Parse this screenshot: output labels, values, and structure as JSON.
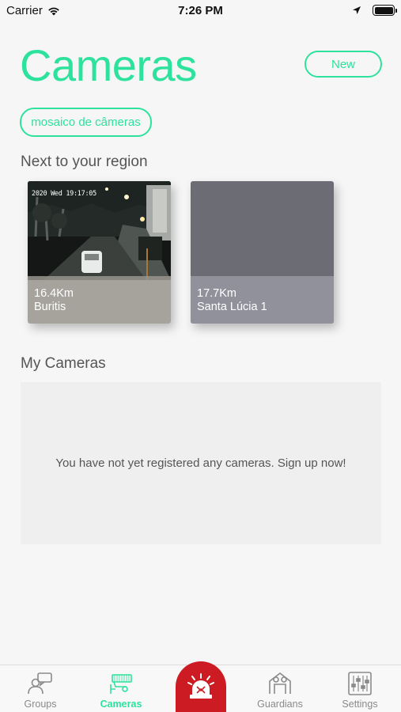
{
  "status_bar": {
    "carrier": "Carrier",
    "time": "7:26 PM"
  },
  "header": {
    "title": "Cameras",
    "new_label": "New"
  },
  "mosaic_label": "mosaico de câmeras",
  "nearby": {
    "section_title": "Next to your region",
    "cameras": [
      {
        "distance": "16.4Km",
        "name": "Buritis",
        "timestamp": "2020 Wed 19:17:05"
      },
      {
        "distance": "17.7Km",
        "name": "Santa Lúcia 1"
      }
    ]
  },
  "my_cameras": {
    "section_title": "My Cameras",
    "empty_message": "You have not yet registered any cameras. Sign up now!"
  },
  "tab_bar": {
    "tabs": [
      {
        "label": "Groups",
        "icon": "groups-icon"
      },
      {
        "label": "Cameras",
        "icon": "camera-icon",
        "active": true
      },
      {
        "label": "Guardians",
        "icon": "guardians-icon"
      },
      {
        "label": "Settings",
        "icon": "settings-icon"
      }
    ],
    "alarm_icon": "siren-icon"
  },
  "colors": {
    "accent": "#2de29c",
    "alarm": "#cc1b22",
    "background": "#f6f6f6"
  }
}
